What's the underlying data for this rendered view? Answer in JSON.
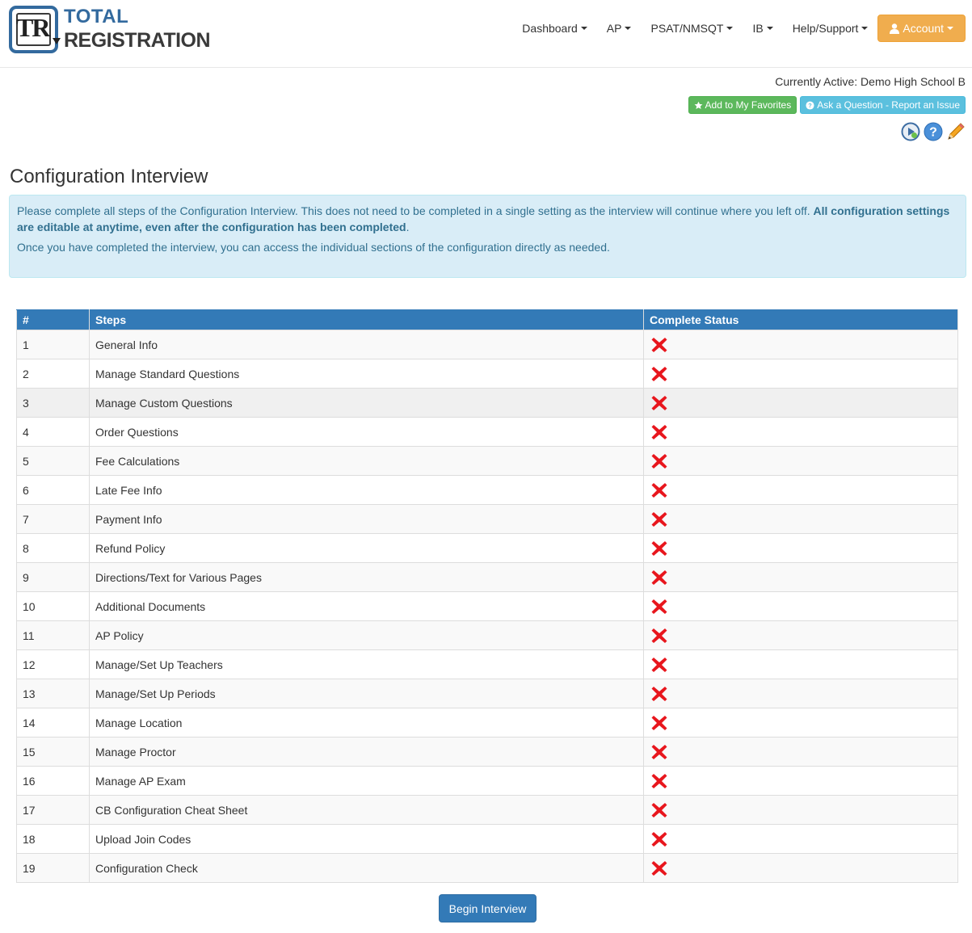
{
  "brand": {
    "mark_text": "TR",
    "line1": "TOTAL",
    "line2": "REGISTRATION"
  },
  "nav": {
    "items": [
      "Dashboard",
      "AP",
      "PSAT/NMSQT",
      "IB",
      "Help/Support"
    ],
    "account_label": "Account"
  },
  "header": {
    "active_school": "Currently Active: Demo High School B",
    "favorites_label": "Add to My Favorites",
    "ask_label": "Ask a Question - Report an Issue"
  },
  "page": {
    "title": "Configuration Interview",
    "alert_text_1": "Please complete all steps of the Configuration Interview. This does not need to be completed in a single setting as the interview will continue where you left off. ",
    "alert_bold": "All configuration settings are editable at anytime, even after the configuration has been completed",
    "alert_text_1_end": ".",
    "alert_text_2": "Once you have completed the interview, you can access the individual sections of the configuration directly as needed."
  },
  "table": {
    "headers": [
      "#",
      "Steps",
      "Complete Status"
    ],
    "rows": [
      {
        "num": "1",
        "step": "General Info"
      },
      {
        "num": "2",
        "step": "Manage Standard Questions"
      },
      {
        "num": "3",
        "step": "Manage Custom Questions"
      },
      {
        "num": "4",
        "step": "Order Questions"
      },
      {
        "num": "5",
        "step": "Fee Calculations"
      },
      {
        "num": "6",
        "step": "Late Fee Info"
      },
      {
        "num": "7",
        "step": "Payment Info"
      },
      {
        "num": "8",
        "step": "Refund Policy"
      },
      {
        "num": "9",
        "step": "Directions/Text for Various Pages"
      },
      {
        "num": "10",
        "step": "Additional Documents"
      },
      {
        "num": "11",
        "step": "AP Policy"
      },
      {
        "num": "12",
        "step": "Manage/Set Up Teachers"
      },
      {
        "num": "13",
        "step": "Manage/Set Up Periods"
      },
      {
        "num": "14",
        "step": "Manage Location"
      },
      {
        "num": "15",
        "step": "Manage Proctor"
      },
      {
        "num": "16",
        "step": "Manage AP Exam"
      },
      {
        "num": "17",
        "step": "CB Configuration Cheat Sheet"
      },
      {
        "num": "18",
        "step": "Upload Join Codes"
      },
      {
        "num": "19",
        "step": "Configuration Check"
      }
    ]
  },
  "begin_label": "Begin Interview",
  "colors": {
    "primary": "#337ab7",
    "warning": "#f0ad4e",
    "success": "#5cb85c",
    "info": "#5bc0de",
    "alert_bg": "#d9edf7",
    "incomplete": "#e8161d"
  },
  "icons": {
    "incomplete_status": "red-x-icon",
    "tools": [
      "video-tutorial-icon",
      "help-icon",
      "edit-pencil-icon"
    ]
  }
}
